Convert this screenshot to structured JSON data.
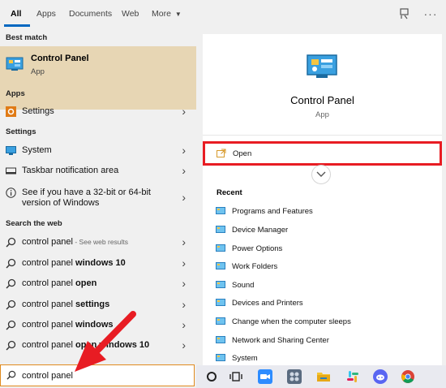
{
  "tabs": [
    {
      "label": "All",
      "active": true
    },
    {
      "label": "Apps"
    },
    {
      "label": "Documents"
    },
    {
      "label": "Web"
    },
    {
      "label": "More"
    }
  ],
  "top_icons": [
    "feedback-icon",
    "more-options-icon"
  ],
  "best_match": {
    "heading": "Best match",
    "title": "Control Panel",
    "subtitle": "App"
  },
  "apps": {
    "heading": "Apps",
    "items": [
      {
        "label": "Settings"
      }
    ]
  },
  "settings": {
    "heading": "Settings",
    "items": [
      {
        "label": "System"
      },
      {
        "label": "Taskbar notification area"
      },
      {
        "label": "See if you have a 32-bit or 64-bit version of Windows"
      }
    ]
  },
  "web": {
    "heading": "Search the web",
    "items": [
      {
        "base": "control panel",
        "bold": "",
        "hint": " - See web results"
      },
      {
        "base": "control panel ",
        "bold": "windows 10",
        "hint": ""
      },
      {
        "base": "control panel ",
        "bold": "open",
        "hint": ""
      },
      {
        "base": "control panel ",
        "bold": "settings",
        "hint": ""
      },
      {
        "base": "control panel ",
        "bold": "windows",
        "hint": ""
      },
      {
        "base": "control panel ",
        "bold": "open windows 10",
        "hint": ""
      }
    ]
  },
  "search": {
    "value": "control panel"
  },
  "detail": {
    "title": "Control Panel",
    "subtitle": "App",
    "open_label": "Open",
    "recent_heading": "Recent",
    "recent": [
      "Programs and Features",
      "Device Manager",
      "Power Options",
      "Work Folders",
      "Sound",
      "Devices and Printers",
      "Change when the computer sleeps",
      "Network and Sharing Center",
      "System"
    ]
  },
  "colors": {
    "accent": "#0067c0",
    "best_match_bg": "#e7d6b4",
    "open_highlight": "#e81c23",
    "arrow": "#e81c23"
  },
  "taskbar_icons": [
    "cortana-icon",
    "task-view-icon",
    "zoom-icon",
    "app-icon",
    "file-explorer-icon",
    "slack-icon",
    "discord-icon",
    "chrome-icon"
  ]
}
